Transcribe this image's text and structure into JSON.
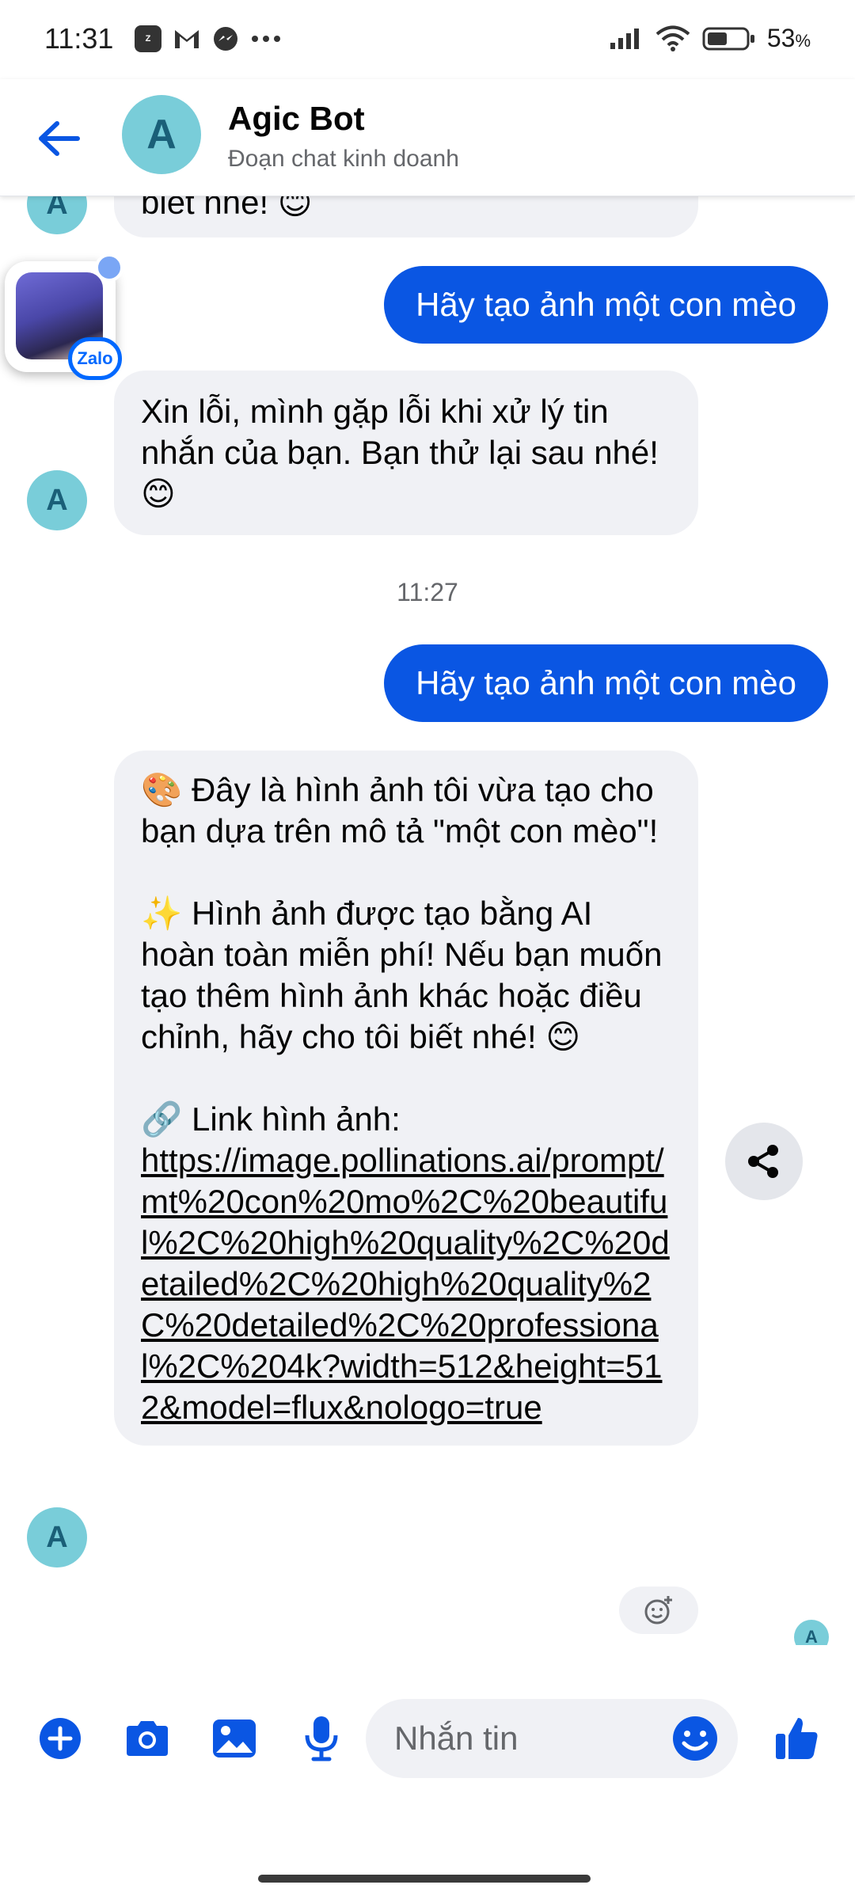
{
  "status_bar": {
    "time": "11:31",
    "battery_pct": "53",
    "battery_unit": "%",
    "left_icons": [
      "zalo-icon",
      "gmail-icon",
      "messenger-icon",
      "more-icon"
    ],
    "right_icons": [
      "signal-icon",
      "wifi-icon",
      "battery-icon"
    ]
  },
  "header": {
    "avatar_letter": "A",
    "name": "Agic Bot",
    "subtitle": "Đoạn chat kinh doanh"
  },
  "floating_bubble": {
    "badge_label": "Zalo"
  },
  "messages": {
    "partial_top_text": "biết nhé! 😊",
    "avatar_letter": "A",
    "out_1": "Hãy tạo ảnh một con mèo",
    "in_1": "Xin lỗi, mình gặp lỗi khi xử lý tin nhắn của bạn. Bạn thử lại sau nhé! 😊",
    "timestamp": "11:27",
    "out_2": "Hãy tạo ảnh một con mèo",
    "in_2_p1": "🎨 Đây là hình ảnh tôi vừa tạo cho bạn dựa trên mô tả \"một con mèo\"!",
    "in_2_p2": "✨ Hình ảnh được tạo bằng AI hoàn toàn miễn phí! Nếu bạn muốn tạo thêm hình ảnh khác hoặc điều chỉnh, hãy cho tôi biết nhé! 😊",
    "in_2_p3_label": "🔗 Link hình ảnh:",
    "in_2_link": "https://image.pollinations.ai/prompt/mt%20con%20mo%2C%20beautiful%2C%20high%20quality%2C%20detailed%2C%20high%20quality%2C%20detailed%2C%20professional%2C%204k?width=512&height=512&model=flux&nologo=true",
    "seen_avatar_letter": "A"
  },
  "composer": {
    "placeholder": "Nhắn tin",
    "icons": [
      "add-icon",
      "camera-icon",
      "gallery-icon",
      "microphone-icon",
      "emoji-icon",
      "like-icon"
    ]
  },
  "colors": {
    "brand_blue": "#0a56e3",
    "avatar_teal": "#79cdd9",
    "bubble_gray": "#f0f1f5"
  }
}
